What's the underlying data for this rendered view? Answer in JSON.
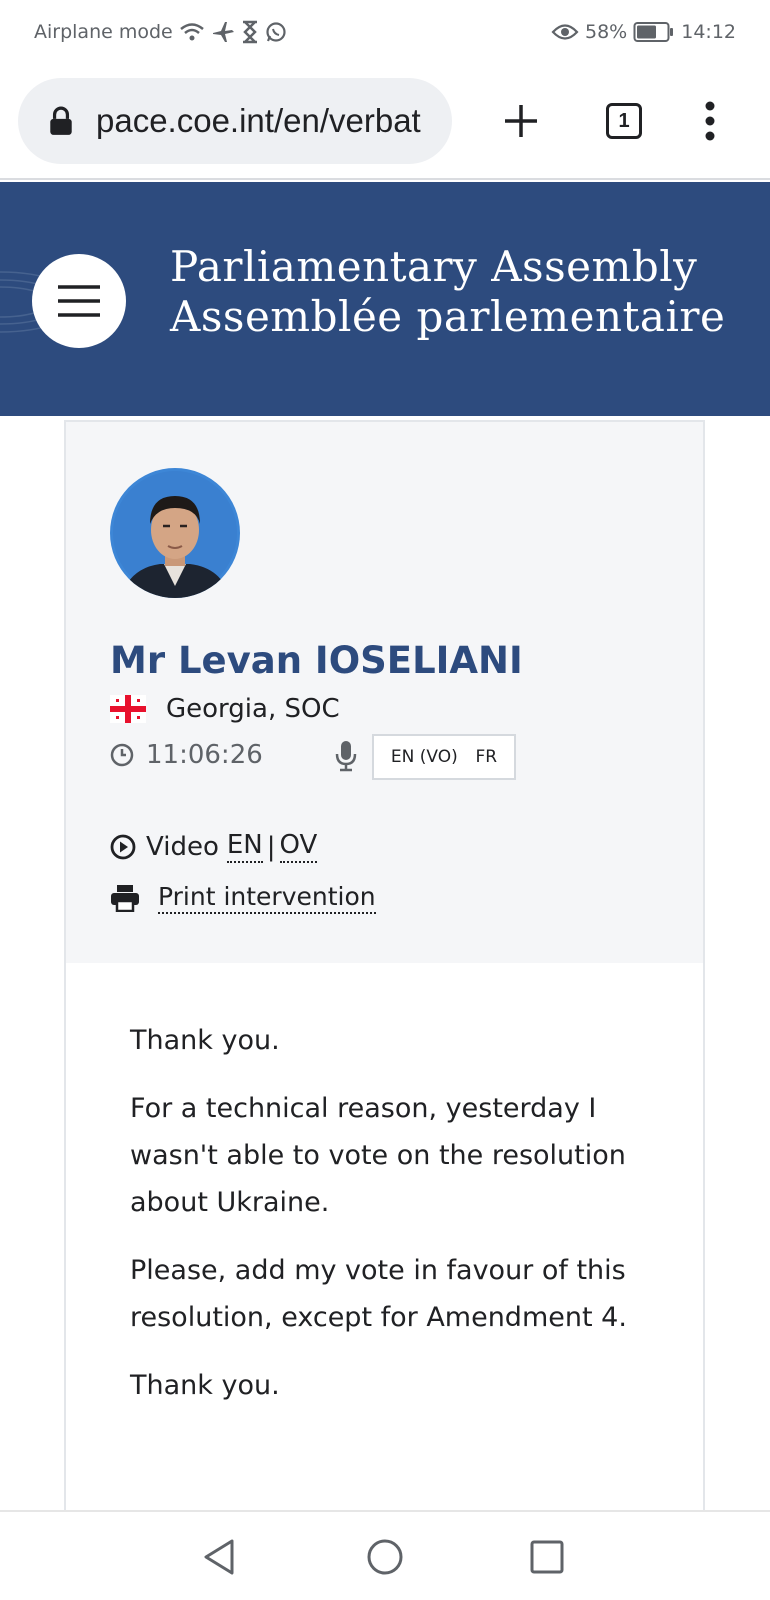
{
  "status_bar": {
    "left_text": "Airplane mode",
    "battery": "58%",
    "time": "14:12"
  },
  "browser": {
    "url": "pace.coe.int/en/verbat",
    "tab_count": "1"
  },
  "header": {
    "title_en": "Parliamentary Assembly",
    "title_fr": "Assemblée parlementaire"
  },
  "speaker": {
    "name": "Mr Levan IOSELIANI",
    "country": "Georgia, SOC",
    "time": "11:06:26",
    "languages": [
      "EN (VO)",
      "FR"
    ],
    "video_label": "Video",
    "video_en": "EN",
    "video_sep": "|",
    "video_ov": "OV",
    "print_label": "Print intervention"
  },
  "transcript": [
    "Thank you.",
    "For a technical reason, yesterday I wasn't able to vote on the resolution about Ukraine.",
    "Please, add my vote in favour of this resolution, except for Amendment 4.",
    "Thank you."
  ],
  "colors": {
    "brand_blue": "#2d4b7e",
    "card_top_bg": "#f5f6f8"
  },
  "icons": {
    "status": [
      "wifi-icon",
      "airplane-icon",
      "hourglass-icon",
      "whatsapp-icon",
      "eye-icon",
      "battery-icon"
    ],
    "browser": [
      "lock-icon",
      "plus-icon",
      "tabs-icon",
      "more-vert-icon"
    ],
    "nav": [
      "back-icon",
      "home-icon",
      "recents-icon"
    ]
  }
}
